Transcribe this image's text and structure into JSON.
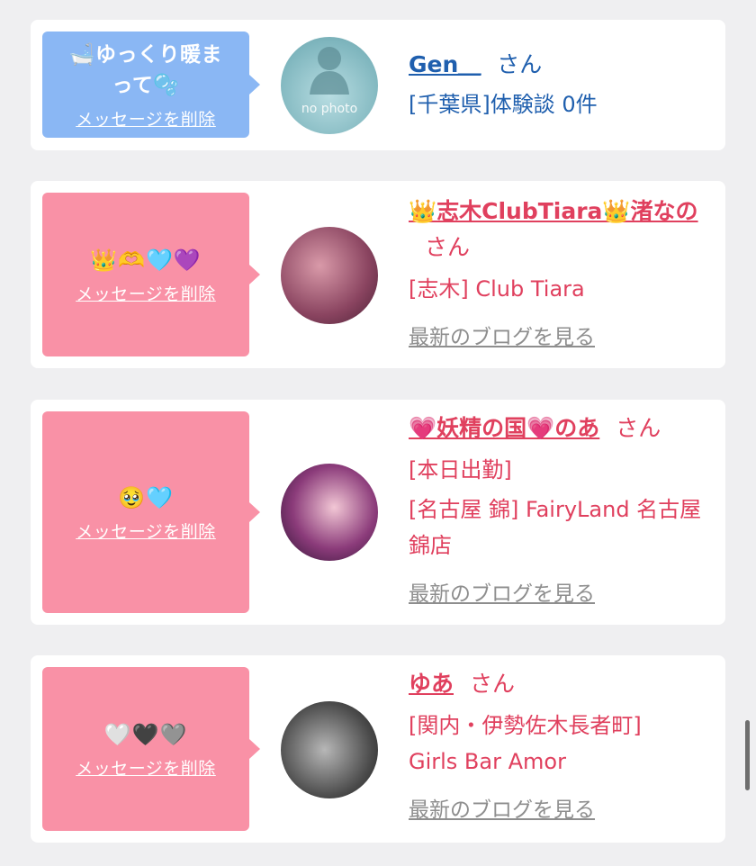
{
  "delete_label": "メッセージを削除",
  "blog_label": "最新のブログを見る",
  "suffix": "さん",
  "cards": [
    {
      "message": "🛁ゆっくり暖まって🫧",
      "avatar_caption": "no photo",
      "name": "Gen＿",
      "details": [
        "[千葉県]体験談 0件"
      ]
    },
    {
      "message": "👑🫶🩵💜",
      "name": "👑志木ClubTiara👑渚なの",
      "details": [
        "[志木] Club Tiara"
      ]
    },
    {
      "message": "🥹🩵",
      "name": "💗妖精の国💗のあ",
      "details": [
        "[本日出勤]",
        "[名古屋 錦] FairyLand 名古屋錦店"
      ]
    },
    {
      "message": "🤍🖤🩶",
      "name": "ゆあ",
      "details": [
        "[関内・伊勢佐木長者町] Girls Bar Amor"
      ]
    }
  ],
  "colors": {
    "blue_bubble": "#8ab7f4",
    "pink_bubble": "#f991a6",
    "blue_text": "#1f5fae",
    "pink_text": "#e0405e",
    "gray_link": "#8e8e8e"
  }
}
